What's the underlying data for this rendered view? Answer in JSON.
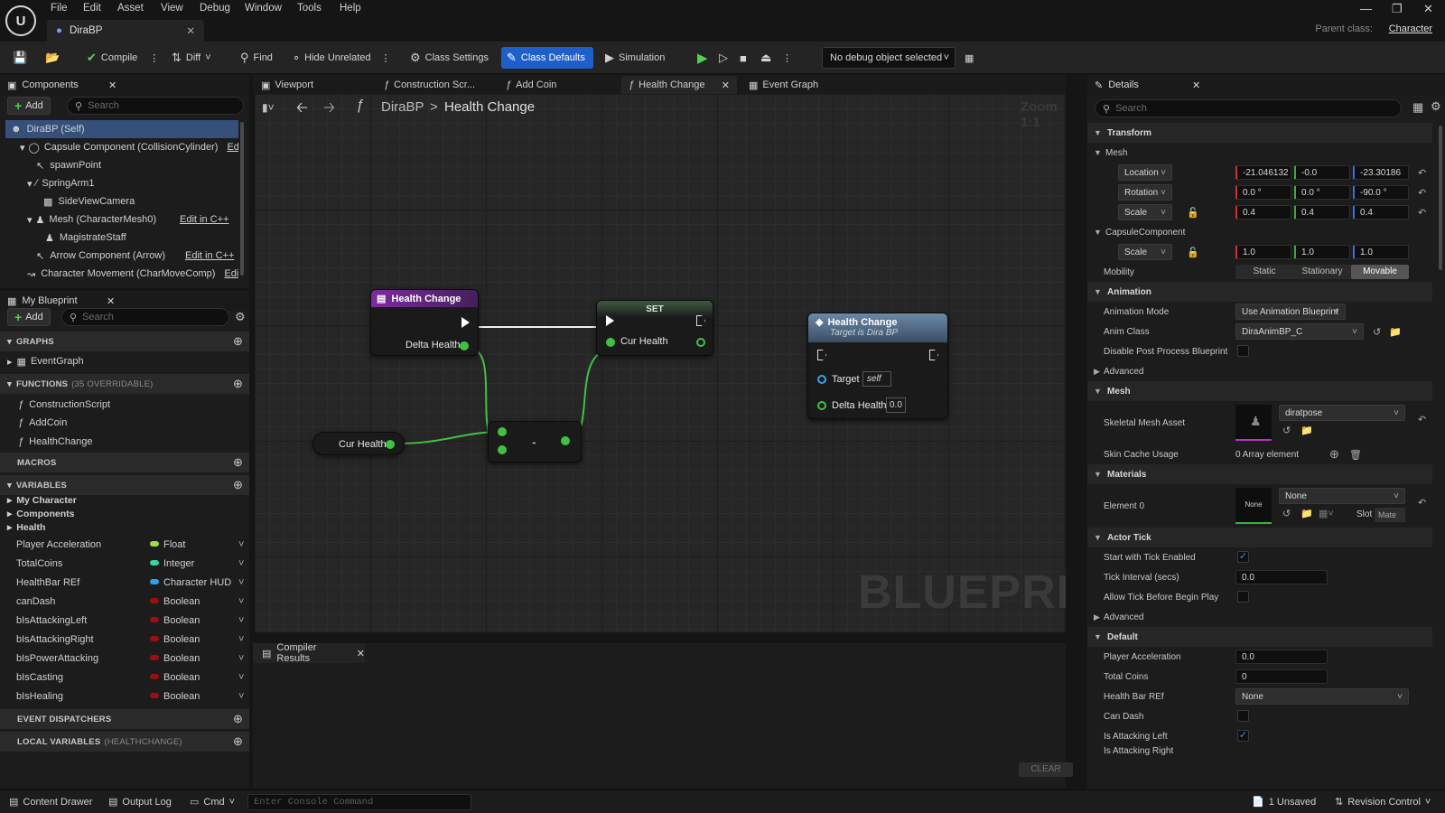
{
  "menu": [
    "File",
    "Edit",
    "Asset",
    "View",
    "Debug",
    "Window",
    "Tools",
    "Help"
  ],
  "logo": "U",
  "document_tab": "DiraBP",
  "parent_class": {
    "label": "Parent class:",
    "value": "Character"
  },
  "toolbar": {
    "compile": "Compile",
    "diff": "Diff",
    "find": "Find",
    "hide_unrelated": "Hide Unrelated",
    "class_settings": "Class Settings",
    "class_defaults": "Class Defaults",
    "simulation": "Simulation",
    "debug_select": "No debug object selected"
  },
  "components": {
    "title": "Components",
    "add": "Add",
    "search_placeholder": "Search",
    "items": [
      {
        "label": "DiraBP (Self)"
      },
      {
        "label": "Capsule Component (CollisionCylinder)",
        "edit": "Edit i"
      },
      {
        "label": "spawnPoint"
      },
      {
        "label": "SpringArm1"
      },
      {
        "label": "SideViewCamera"
      },
      {
        "label": "Mesh (CharacterMesh0)",
        "edit": "Edit in C++"
      },
      {
        "label": "MagistrateStaff"
      },
      {
        "label": "Arrow Component (Arrow)",
        "edit": "Edit in C++"
      },
      {
        "label": "Character Movement (CharMoveComp)",
        "edit": "Edit"
      }
    ]
  },
  "my_blueprint": {
    "title": "My Blueprint",
    "add": "Add",
    "search_placeholder": "Search",
    "graphs_header": "GRAPHS",
    "event_graph": "EventGraph",
    "functions_header": "FUNCTIONS",
    "functions_count": "(35 OVERRIDABLE)",
    "functions": [
      "ConstructionScript",
      "AddCoin",
      "HealthChange"
    ],
    "macros_header": "MACROS",
    "variables_header": "VARIABLES",
    "categories": [
      "My Character",
      "Components",
      "Health"
    ],
    "variables": [
      {
        "name": "Player Acceleration",
        "type": "Float",
        "color": "#9ae03a"
      },
      {
        "name": "TotalCoins",
        "type": "Integer",
        "color": "#2fd6a0"
      },
      {
        "name": "HealthBar REf",
        "type": "Character HUD",
        "color": "#2aa4e8"
      },
      {
        "name": "canDash",
        "type": "Boolean",
        "color": "#9a1010"
      },
      {
        "name": "bIsAttackingLeft",
        "type": "Boolean",
        "color": "#9a1010"
      },
      {
        "name": "bIsAttackingRight",
        "type": "Boolean",
        "color": "#9a1010"
      },
      {
        "name": "bIsPowerAttacking",
        "type": "Boolean",
        "color": "#9a1010"
      },
      {
        "name": "bIsCasting",
        "type": "Boolean",
        "color": "#9a1010"
      },
      {
        "name": "bIsHealing",
        "type": "Boolean",
        "color": "#9a1010"
      }
    ],
    "event_dispatchers_header": "EVENT DISPATCHERS",
    "local_variables_header": "LOCAL VARIABLES",
    "local_variables_scope": "(HEALTHCHANGE)"
  },
  "graph_tabs": [
    "Viewport",
    "Construction Scr...",
    "Add Coin",
    "Health Change",
    "Event Graph"
  ],
  "breadcrumb": {
    "root": "DiraBP",
    "sep": ">",
    "current": "Health Change"
  },
  "zoom_text": "Zoom 1:1",
  "watermark": "BLUEPRINT",
  "nodes": {
    "entry": {
      "title": "Health Change",
      "pin": "Delta Health"
    },
    "set": {
      "title": "SET",
      "pin": "Cur Health"
    },
    "get": {
      "label": "Cur Health"
    },
    "subtract": {
      "symbol": "-"
    },
    "call": {
      "title": "Health Change",
      "subtitle": "Target is Dira BP",
      "target_label": "Target",
      "target_value": "self",
      "delta_label": "Delta Health",
      "delta_value": "0.0"
    }
  },
  "compiler": {
    "tab": "Compiler Results",
    "clear": "CLEAR"
  },
  "details": {
    "title": "Details",
    "search_placeholder": "Search",
    "transform_header": "Transform",
    "mesh_sub": "Mesh",
    "location": {
      "label": "Location",
      "x": "-21.046132",
      "y": "-0.0",
      "z": "-23.30186"
    },
    "rotation": {
      "label": "Rotation",
      "x": "0.0 °",
      "y": "0.0 °",
      "z": "-90.0 °"
    },
    "scale": {
      "label": "Scale",
      "x": "0.4",
      "y": "0.4",
      "z": "0.4"
    },
    "capsule_sub": "CapsuleComponent",
    "capsule_scale": {
      "label": "Scale",
      "x": "1.0",
      "y": "1.0",
      "z": "1.0"
    },
    "mobility": {
      "label": "Mobility",
      "options": [
        "Static",
        "Stationary",
        "Movable"
      ],
      "selected": "Movable"
    },
    "animation_header": "Animation",
    "animation_mode": {
      "label": "Animation Mode",
      "value": "Use Animation Blueprint"
    },
    "anim_class": {
      "label": "Anim Class",
      "value": "DiraAnimBP_C"
    },
    "disable_post": {
      "label": "Disable Post Process Blueprint",
      "checked": false
    },
    "advanced": "Advanced",
    "mesh_header": "Mesh",
    "skeletal_mesh": {
      "label": "Skeletal Mesh Asset",
      "value": "diratpose"
    },
    "skin_cache": {
      "label": "Skin Cache Usage",
      "value": "0 Array element"
    },
    "materials_header": "Materials",
    "element0": {
      "label": "Element 0",
      "thumb": "None",
      "value": "None",
      "slot": "Slot",
      "slot_value": "Mate"
    },
    "actor_tick_header": "Actor Tick",
    "start_tick": {
      "label": "Start with Tick Enabled",
      "checked": true
    },
    "tick_interval": {
      "label": "Tick Interval (secs)",
      "value": "0.0"
    },
    "allow_tick": {
      "label": "Allow Tick Before Begin Play",
      "checked": false
    },
    "advanced2": "Advanced",
    "default_header": "Default",
    "player_accel": {
      "label": "Player Acceleration",
      "value": "0.0"
    },
    "total_coins": {
      "label": "Total Coins",
      "value": "0"
    },
    "health_bar": {
      "label": "Health Bar REf",
      "value": "None"
    },
    "can_dash": {
      "label": "Can Dash",
      "checked": false
    },
    "is_attacking_left": {
      "label": "Is Attacking Left",
      "checked": true
    },
    "is_attacking_right": {
      "label": "Is Attacking Right"
    }
  },
  "statusbar": {
    "content_drawer": "Content Drawer",
    "output_log": "Output Log",
    "cmd": "Cmd",
    "console_placeholder": "Enter Console Command",
    "unsaved": "1 Unsaved",
    "revision": "Revision Control"
  }
}
